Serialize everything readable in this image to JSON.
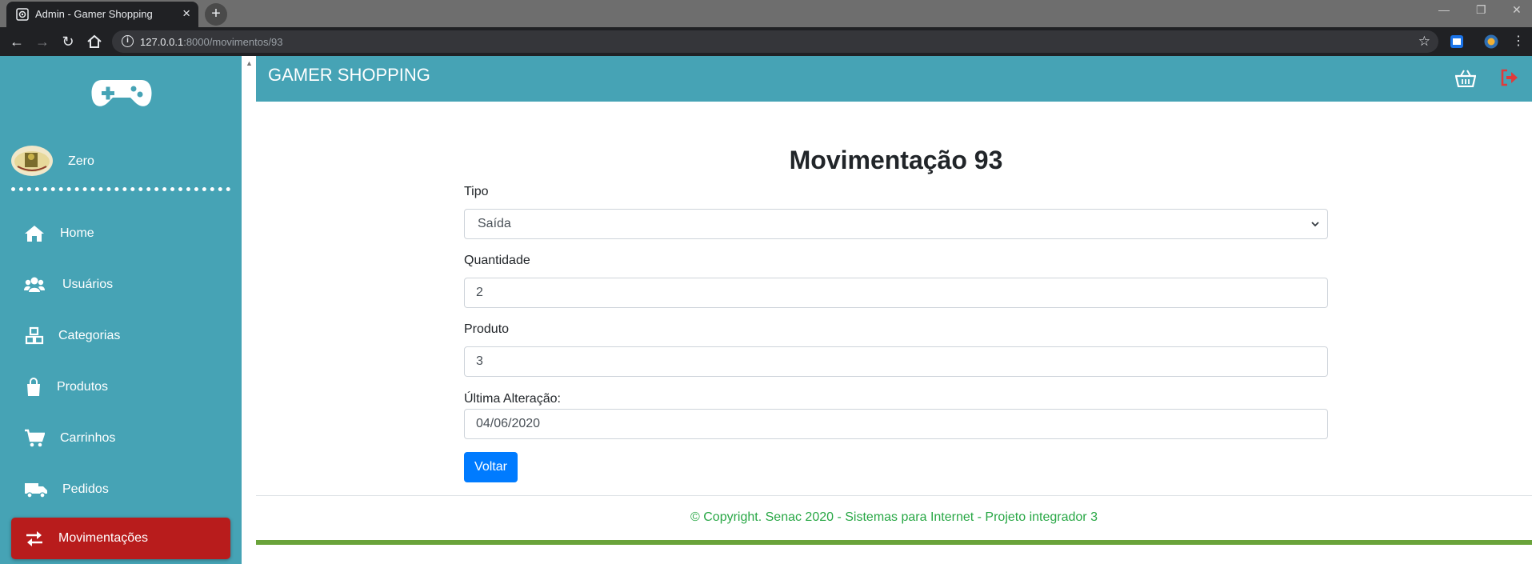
{
  "browser": {
    "tab_title": "Admin - Gamer Shopping",
    "tab_close": "×",
    "new_tab": "+",
    "url_host": "127.0.0.1",
    "url_path": ":8000/movimentos/93",
    "icons": [
      "back-arrow-icon",
      "forward-arrow-icon",
      "reload-icon",
      "home-icon",
      "info-icon",
      "star-icon",
      "extension-icon",
      "profile-icon",
      "kebab-menu-icon"
    ]
  },
  "sidebar": {
    "user_name": "Zero",
    "items": [
      {
        "label": "Home",
        "icon": "home-icon"
      },
      {
        "label": "Usuários",
        "icon": "users-icon"
      },
      {
        "label": "Categorias",
        "icon": "cubes-icon"
      },
      {
        "label": "Produtos",
        "icon": "shopping-bag-icon"
      },
      {
        "label": "Carrinhos",
        "icon": "cart-icon"
      },
      {
        "label": "Pedidos",
        "icon": "truck-icon"
      },
      {
        "label": "Movimentações",
        "icon": "exchange-icon",
        "active": true
      }
    ],
    "active_color": "#b81c1c",
    "background_color": "#46a3b5"
  },
  "header": {
    "brand": "GAMER SHOPPING",
    "icons": [
      "basket-icon",
      "logout-icon"
    ],
    "logout_color": "#e03a3a"
  },
  "form": {
    "title": "Movimentação 93",
    "tipo_label": "Tipo",
    "tipo_value": "Saída",
    "quantidade_label": "Quantidade",
    "quantidade_value": "2",
    "produto_label": "Produto",
    "produto_value": "3",
    "ultima_label": "Última Alteração:",
    "ultima_value": "04/06/2020",
    "back_label": "Voltar",
    "button_color": "#007bff"
  },
  "footer": {
    "text": "© Copyright. Senac 2020 - Sistemas para Internet - Projeto integrador 3",
    "text_color": "#28a745",
    "bar_color": "#6aa33a"
  }
}
